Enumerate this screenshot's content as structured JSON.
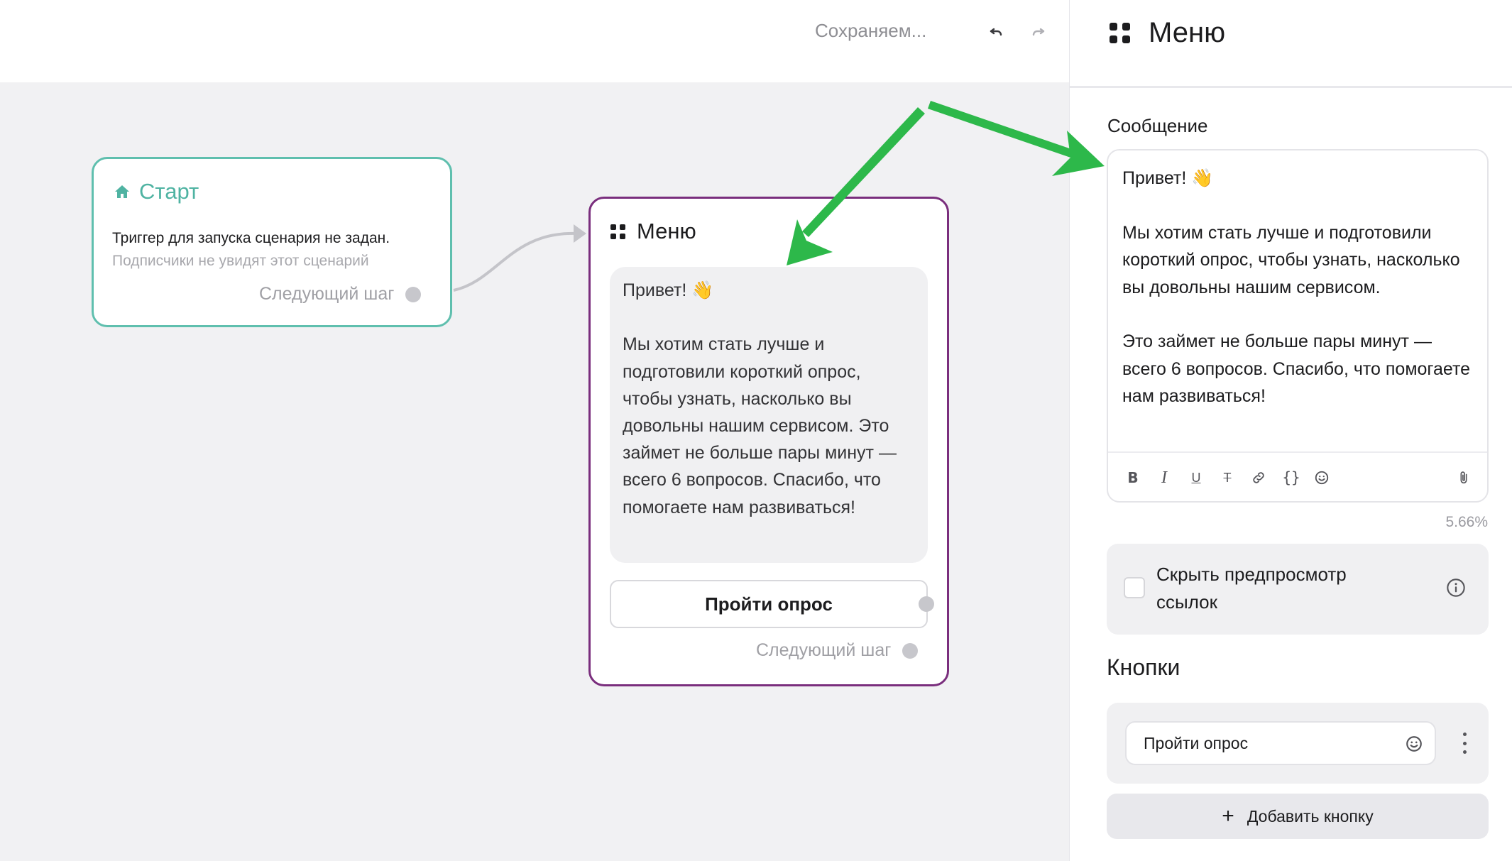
{
  "topbar": {
    "saving_text": "Сохраняем..."
  },
  "start_node": {
    "title": "Старт",
    "description": "Триггер для запуска сценария не задан.",
    "subtext": "Подписчики не увидят этот сценарий",
    "next_step": "Следующий шаг"
  },
  "menu_node": {
    "title": "Меню",
    "message": "Привет! 👋\n\nМы хотим стать лучше и подготовили короткий опрос, чтобы узнать, насколько вы довольны нашим сервисом. Это займет не больше пары минут — всего 6 вопросов. Спасибо, что помогаете нам развиваться!",
    "button_label": "Пройти опрос",
    "next_step": "Следующий шаг"
  },
  "panel": {
    "title": "Меню",
    "message_label": "Сообщение",
    "message_text": "Привет! 👋\n\nМы хотим стать лучше и подготовили короткий опрос, чтобы узнать, насколько вы довольны нашим сервисом.\n\nЭто займет не больше пары минут — всего 6 вопросов. Спасибо, что помогаете нам развиваться!",
    "char_percent": "5.66%",
    "hide_preview_label": "Скрыть предпросмотр ссылок",
    "hide_preview_checked": false,
    "buttons_title": "Кнопки",
    "button_value": "Пройти опрос",
    "add_button_label": "Добавить кнопку"
  },
  "toolbar_icons": [
    "bold-icon",
    "italic-icon",
    "underline-icon",
    "strikethrough-icon",
    "link-icon",
    "code-braces-icon",
    "emoji-icon",
    "attach-icon"
  ],
  "colors": {
    "start_border": "#5fbfae",
    "menu_border": "#7a2e7d",
    "arrow": "#2db84a"
  }
}
